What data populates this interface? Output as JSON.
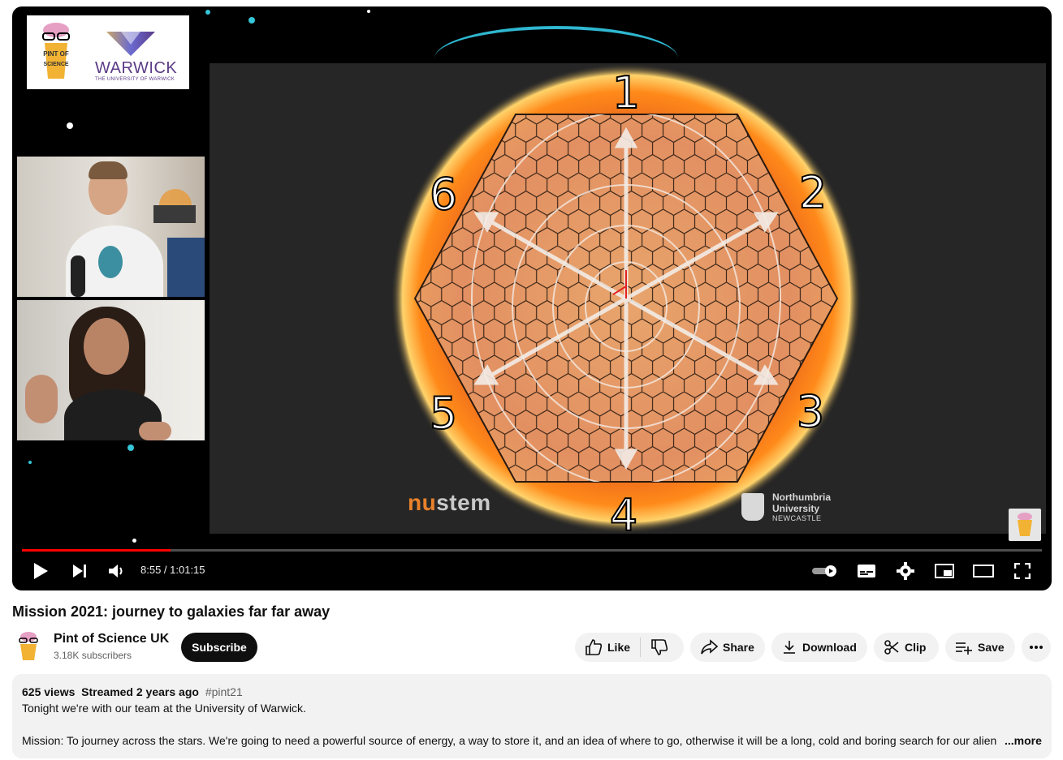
{
  "video": {
    "title": "Mission 2021: journey to galaxies far far away",
    "time_current": "8:55",
    "time_total": "1:01:15",
    "time_display": "8:55 / 1:01:15",
    "progress_fraction": 0.1455
  },
  "slide": {
    "segment_numbers": [
      "1",
      "2",
      "3",
      "4",
      "5",
      "6"
    ],
    "nustem_nu": "nu",
    "nustem_stem": "stem",
    "northumbria_line1": "Northumbria",
    "northumbria_line2": "University",
    "northumbria_line3": "NEWCASTLE"
  },
  "overlay_logos": {
    "warwick": "WARWICK",
    "warwick_sub": "THE UNIVERSITY OF WARWICK",
    "pint_text": "PINT OF SCIENCE"
  },
  "channel": {
    "name": "Pint of Science UK",
    "subscribers": "3.18K subscribers",
    "subscribe_label": "Subscribe"
  },
  "actions": {
    "like": "Like",
    "share": "Share",
    "download": "Download",
    "clip": "Clip",
    "save": "Save"
  },
  "description": {
    "views": "625 views",
    "streamed": "Streamed 2 years ago",
    "hashtag": "#pint21",
    "line1": "Tonight we're with our team at the University of Warwick.",
    "line2": "Mission: To journey across the stars. We're going to need a powerful source of energy, a way to store it, and an idea of where to go, otherwise it will be a long, cold and boring search for our alien n",
    "more": "...more"
  },
  "colors": {
    "progress": "#ff0000",
    "accent_cyan": "#35c6d8",
    "warwick_purple": "#5b3b87",
    "nustem_orange": "#e8812b"
  },
  "icons": [
    "play-icon",
    "next-icon",
    "volume-icon",
    "autoplay-toggle-icon",
    "captions-icon",
    "settings-gear-icon",
    "miniplayer-icon",
    "theater-mode-icon",
    "fullscreen-icon",
    "thumbs-up-icon",
    "thumbs-down-icon",
    "share-icon",
    "download-icon",
    "scissors-icon",
    "playlist-add-icon",
    "more-horizontal-icon"
  ]
}
